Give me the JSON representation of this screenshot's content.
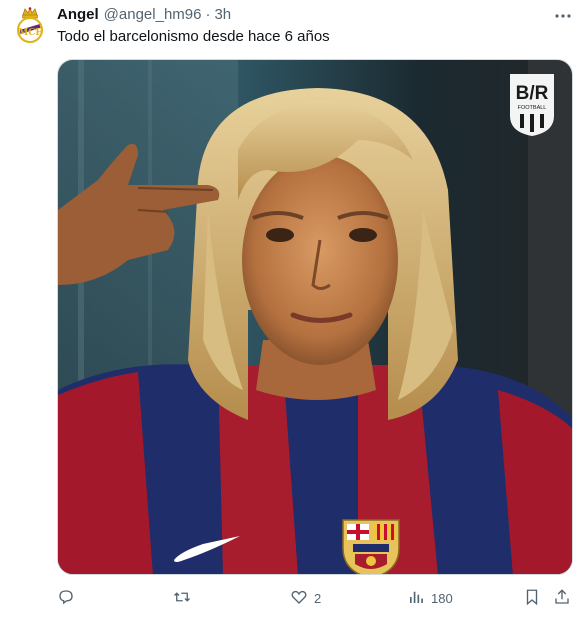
{
  "tweet": {
    "author_name": "Angel",
    "author_handle": "@angel_hm96",
    "separator": "·",
    "time": "3h",
    "text": "Todo el barcelonismo desde hace 6 años"
  },
  "media": {
    "watermark": "B/R FOOTBALL",
    "description_icons": [
      "brand-logo",
      "club-crest",
      "swoosh-logo"
    ]
  },
  "actions": {
    "reply_count": "",
    "retweet_count": "",
    "like_count": "2",
    "views_count": "180"
  },
  "icons": {
    "avatar": "real-madrid-crest-icon",
    "more": "more-icon",
    "reply": "reply-icon",
    "retweet": "retweet-icon",
    "like": "heart-icon",
    "views": "views-icon",
    "bookmark": "bookmark-icon",
    "share": "share-icon"
  },
  "colors": {
    "text_primary": "#0f1419",
    "text_secondary": "#536471",
    "border": "#cfd9de"
  }
}
